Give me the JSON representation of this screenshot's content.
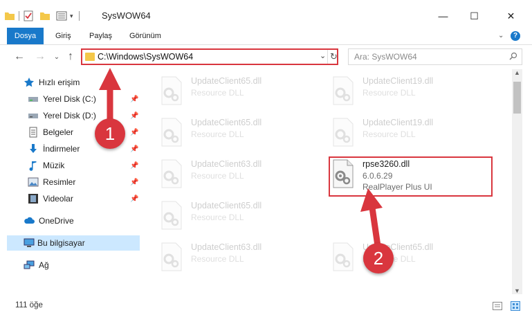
{
  "window": {
    "title": "SysWOW64",
    "minimize_glyph": "—",
    "maximize_glyph": "☐",
    "close_glyph": "✕"
  },
  "ribbon": {
    "tabs": [
      {
        "label": "Dosya",
        "active": true
      },
      {
        "label": "Giriş",
        "active": false
      },
      {
        "label": "Paylaş",
        "active": false
      },
      {
        "label": "Görünüm",
        "active": false
      }
    ],
    "help_glyph": "?"
  },
  "address": {
    "path": "C:\\Windows\\SysWOW64",
    "search_placeholder": "Ara: SysWOW64"
  },
  "sidebar": {
    "items": [
      {
        "label": "Hızlı erişim",
        "icon": "star-icon",
        "pinned": false
      },
      {
        "label": "Yerel Disk (C:)",
        "icon": "drive-icon",
        "pinned": true
      },
      {
        "label": "Yerel Disk (D:)",
        "icon": "drive-icon",
        "pinned": true
      },
      {
        "label": "Belgeler",
        "icon": "documents-icon",
        "pinned": true
      },
      {
        "label": "İndirmeler",
        "icon": "downloads-icon",
        "pinned": true
      },
      {
        "label": "Müzik",
        "icon": "music-icon",
        "pinned": true
      },
      {
        "label": "Resimler",
        "icon": "pictures-icon",
        "pinned": true
      },
      {
        "label": "Videolar",
        "icon": "videos-icon",
        "pinned": true
      },
      {
        "label": "OneDrive",
        "icon": "cloud-icon",
        "pinned": false
      },
      {
        "label": "Bu bilgisayar",
        "icon": "computer-icon",
        "pinned": false,
        "selected": true
      },
      {
        "label": "Ağ",
        "icon": "network-icon",
        "pinned": false
      }
    ]
  },
  "files": [
    {
      "name": "UpdateClient65.dll",
      "type": "Resource DLL",
      "faded": true
    },
    {
      "name": "UpdateClient19.dll",
      "type": "Resource DLL",
      "faded": true
    },
    {
      "name": "UpdateClient65.dll",
      "type": "Resource DLL",
      "faded": true
    },
    {
      "name": "UpdateClient19.dll",
      "type": "Resource DLL",
      "faded": true
    },
    {
      "name": "UpdateClient63.dll",
      "type": "Resource DLL",
      "faded": true
    },
    {
      "name": "rpse3260.dll",
      "version": "6.0.6.29",
      "type": "RealPlayer Plus UI",
      "faded": false
    },
    {
      "name": "UpdateClient65.dll",
      "type": "Resource DLL",
      "faded": true
    },
    {
      "name": "UpdateClient63.dll",
      "type": "Resource DLL",
      "faded": true
    },
    {
      "name": "UpdateClient65.dll",
      "type": "Resource DLL",
      "faded": true
    }
  ],
  "status": {
    "item_count": "111 öğe"
  },
  "annotations": {
    "step1": "1",
    "step2": "2",
    "color": "#d9363e"
  },
  "colors": {
    "accent": "#1979ca",
    "selection": "#cce8ff"
  }
}
